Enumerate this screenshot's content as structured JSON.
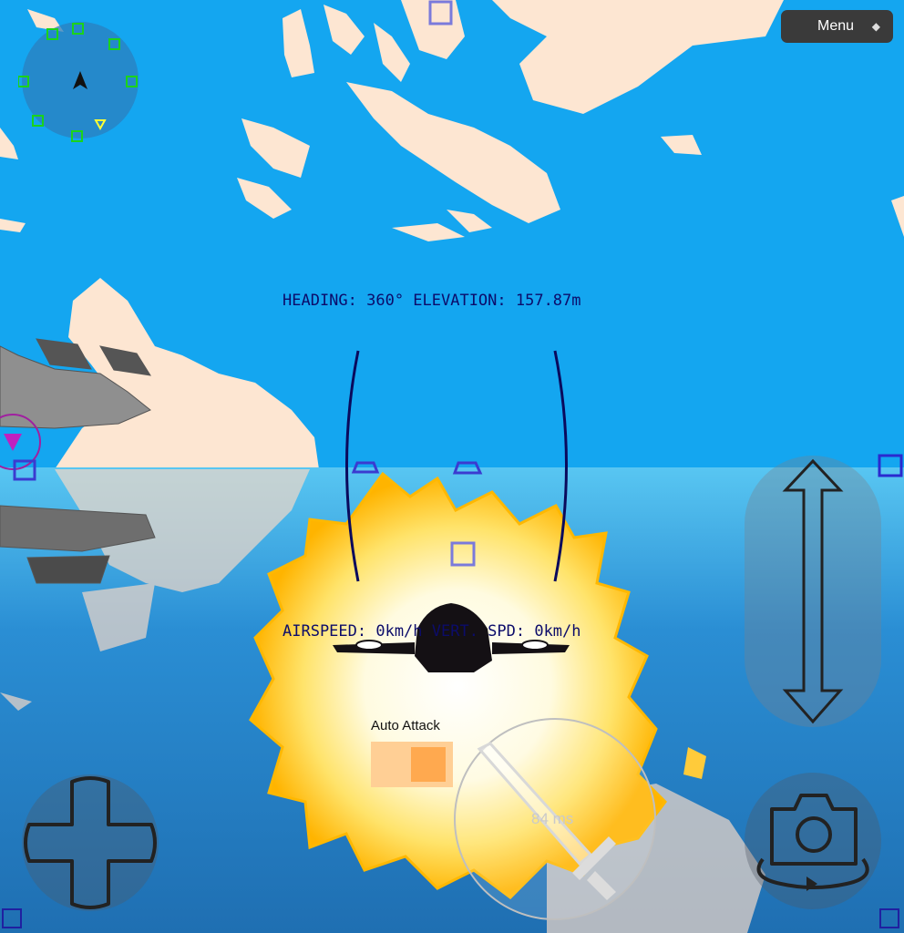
{
  "menu": {
    "label": "Menu"
  },
  "hud": {
    "heading_line": "HEADING: 360° ELEVATION: 157.87m",
    "speed_line": "AIRSPEED: 0km/h VERT. SPD: 0km/h"
  },
  "auto_attack": {
    "label": "Auto Attack",
    "enabled": true
  },
  "latency": "84 ms",
  "colors": {
    "sky": "#14a6f0",
    "sea": "#2b8fd6",
    "hud_text": "#0c0c6a",
    "toggle_on": "#ffa94f",
    "menu_bg": "#3a3a3a"
  },
  "icons": [
    "compass-radar-icon",
    "camera-rotate-icon",
    "sword-icon",
    "dpad-icon",
    "vertical-arrow-icon"
  ]
}
